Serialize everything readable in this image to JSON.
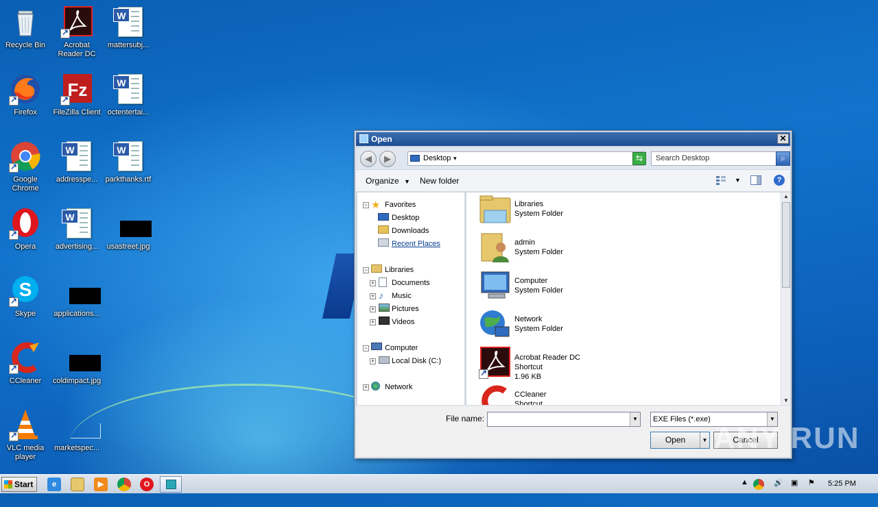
{
  "desktop": {
    "icons": [
      {
        "label": "Recycle Bin",
        "icon": "recycle-bin-icon"
      },
      {
        "label": "Acrobat Reader DC",
        "icon": "acrobat-icon"
      },
      {
        "label": "mattersubj...",
        "icon": "word-doc-icon"
      },
      {
        "label": "Firefox",
        "icon": "firefox-icon"
      },
      {
        "label": "FileZilla Client",
        "icon": "filezilla-icon"
      },
      {
        "label": "octentertai...",
        "icon": "word-doc-icon"
      },
      {
        "label": "Google Chrome",
        "icon": "chrome-icon"
      },
      {
        "label": "addresspe...",
        "icon": "word-doc-icon"
      },
      {
        "label": "parkthanks.rtf",
        "icon": "word-doc-icon"
      },
      {
        "label": "Opera",
        "icon": "opera-icon"
      },
      {
        "label": "advertising...",
        "icon": "word-doc-icon"
      },
      {
        "label": "usastreet.jpg",
        "icon": "image-thumbnail-icon"
      },
      {
        "label": "Skype",
        "icon": "skype-icon"
      },
      {
        "label": "applications...",
        "icon": "image-thumbnail-icon"
      },
      {
        "label": "CCleaner",
        "icon": "ccleaner-icon"
      },
      {
        "label": "coldimpact.jpg",
        "icon": "image-thumbnail-icon"
      },
      {
        "label": "VLC media player",
        "icon": "vlc-icon"
      },
      {
        "label": "marketspec...",
        "icon": "image-thumbnail-icon"
      }
    ]
  },
  "dialog": {
    "title": "Open",
    "close": "✕",
    "address": "Desktop",
    "search_placeholder": "Search Desktop",
    "toolbar": {
      "organize": "Organize",
      "new_folder": "New folder",
      "help": "?"
    },
    "nav": {
      "favorites": "Favorites",
      "desktop": "Desktop",
      "downloads": "Downloads",
      "recent": "Recent Places",
      "libraries": "Libraries",
      "documents": "Documents",
      "music": "Music",
      "pictures": "Pictures",
      "videos": "Videos",
      "computer": "Computer",
      "local_disk": "Local Disk (C:)",
      "network": "Network"
    },
    "items": [
      {
        "name": "Libraries",
        "type": "System Folder",
        "size": ""
      },
      {
        "name": "admin",
        "type": "System Folder",
        "size": ""
      },
      {
        "name": "Computer",
        "type": "System Folder",
        "size": ""
      },
      {
        "name": "Network",
        "type": "System Folder",
        "size": ""
      },
      {
        "name": "Acrobat Reader DC",
        "type": "Shortcut",
        "size": "1.96 KB"
      },
      {
        "name": "CCleaner",
        "type": "Shortcut",
        "size": ""
      }
    ],
    "file_name_label": "File name:",
    "file_name_value": "",
    "file_type": "EXE Files (*.exe)",
    "open_label": "Open",
    "cancel_label": "Cancel"
  },
  "taskbar": {
    "start_label": "Start",
    "clock": "5:25 PM"
  },
  "watermark": "ANY RUN"
}
